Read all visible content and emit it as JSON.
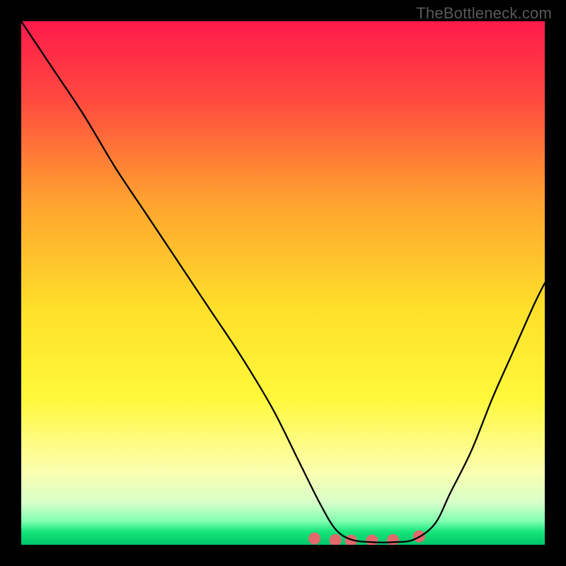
{
  "watermark": "TheBottleneck.com",
  "chart_data": {
    "type": "line",
    "title": "",
    "xlabel": "",
    "ylabel": "",
    "xlim": [
      0,
      100
    ],
    "ylim": [
      0,
      100
    ],
    "grid": false,
    "legend": false,
    "gradient_stops": [
      {
        "offset": 0.0,
        "color": "#ff1a4b"
      },
      {
        "offset": 0.15,
        "color": "#ff4a3f"
      },
      {
        "offset": 0.35,
        "color": "#ffa52f"
      },
      {
        "offset": 0.55,
        "color": "#ffe02a"
      },
      {
        "offset": 0.72,
        "color": "#fff83a"
      },
      {
        "offset": 0.86,
        "color": "#fbffb0"
      },
      {
        "offset": 0.92,
        "color": "#d7ffc9"
      },
      {
        "offset": 0.955,
        "color": "#7fffb0"
      },
      {
        "offset": 0.975,
        "color": "#16e57a"
      },
      {
        "offset": 1.0,
        "color": "#00c56a"
      }
    ],
    "series": [
      {
        "name": "bottleneck-curve",
        "x": [
          0,
          6,
          12,
          18,
          24,
          30,
          36,
          42,
          48,
          53,
          57,
          60,
          63,
          67,
          71,
          75,
          79,
          82,
          86,
          90,
          94,
          98,
          100
        ],
        "y": [
          100,
          91,
          82,
          72,
          63,
          54,
          45,
          36,
          26,
          16,
          8,
          3,
          1,
          0.5,
          0.5,
          1,
          4,
          10,
          18,
          28,
          37,
          46,
          50
        ]
      },
      {
        "name": "optimal-markers",
        "type": "scatter",
        "x": [
          56,
          60,
          63,
          67,
          71,
          76
        ],
        "y": [
          1.2,
          0.9,
          0.8,
          0.8,
          0.9,
          1.6
        ]
      }
    ],
    "marker_color": "#e2696b",
    "curve_color": "#000000"
  }
}
